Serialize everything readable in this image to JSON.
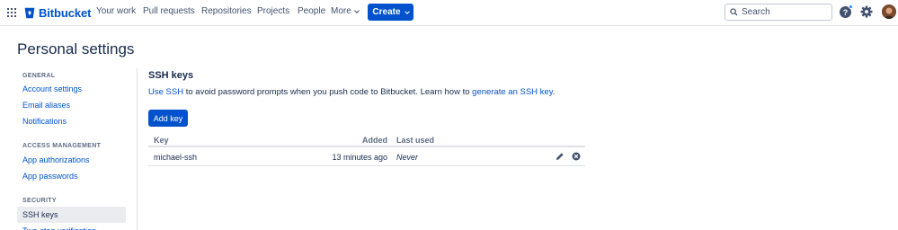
{
  "nav": {
    "brand": "Bitbucket",
    "items": [
      "Your work",
      "Pull requests",
      "Repositories",
      "Projects",
      "People"
    ],
    "more_label": "More",
    "create_label": "Create",
    "search_placeholder": "Search",
    "help_label": "?"
  },
  "page": {
    "title": "Personal settings"
  },
  "sidebar": {
    "sections": [
      {
        "heading": "GENERAL",
        "items": [
          "Account settings",
          "Email aliases",
          "Notifications"
        ]
      },
      {
        "heading": "ACCESS MANAGEMENT",
        "items": [
          "App authorizations",
          "App passwords"
        ]
      },
      {
        "heading": "SECURITY",
        "items": [
          "SSH keys",
          "Two-step verification"
        ]
      }
    ],
    "active_item": "SSH keys"
  },
  "main": {
    "title": "SSH keys",
    "desc_link1": "Use SSH",
    "desc_mid": " to avoid password prompts when you push code to Bitbucket. Learn how to ",
    "desc_link2": "generate an SSH key",
    "desc_end": ".",
    "add_label": "Add key",
    "table": {
      "headers": {
        "key": "Key",
        "added": "Added",
        "last_used": "Last used"
      },
      "rows": [
        {
          "key": "michael-ssh",
          "added": "13 minutes ago",
          "last_used": "Never"
        }
      ]
    }
  },
  "colors": {
    "brand": "#0052cc",
    "text": "#172b4d",
    "muted": "#5e6c84",
    "border": "#dfe1e6"
  }
}
